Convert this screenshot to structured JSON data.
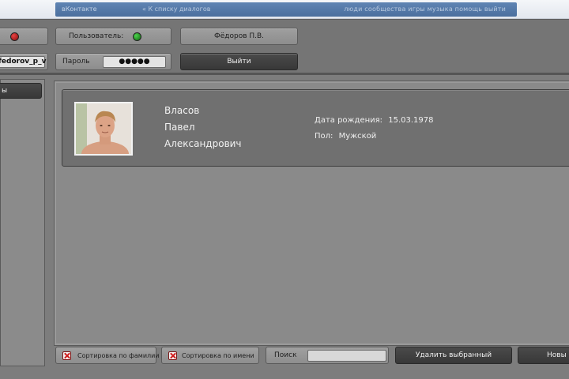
{
  "browser": {
    "logo": "вКонтакте",
    "subtitle": "« К списку диалогов",
    "links": "люди   сообщества   игры   музыка   помощь   выйти"
  },
  "toolbar": {
    "username_value": "fedorov_p_v",
    "user_label": "Пользователь:",
    "password_label": "Пароль",
    "password_value": "●●●●●",
    "current_user": "Фёдоров П.В.",
    "logout_label": "Выйти"
  },
  "sidebar": {
    "items": [
      {
        "label": "ы"
      }
    ]
  },
  "person": {
    "surname": "Власов",
    "first_name": "Павел",
    "patronymic": "Александрович",
    "birth_label": "Дата рождения:",
    "birth_value": "15.03.1978",
    "gender_label": "Пол:",
    "gender_value": "Мужской"
  },
  "bottom": {
    "sort_surname_label": "Сортировка по фамилии",
    "sort_name_label": "Сортировка по имени",
    "search_label": "Поиск",
    "search_value": "",
    "delete_label": "Удалить выбранный",
    "new_label": "Новы"
  },
  "colors": {
    "status_red": "#c81f1f",
    "status_green": "#1fa31f",
    "dark_button": "#3f3f3f"
  }
}
